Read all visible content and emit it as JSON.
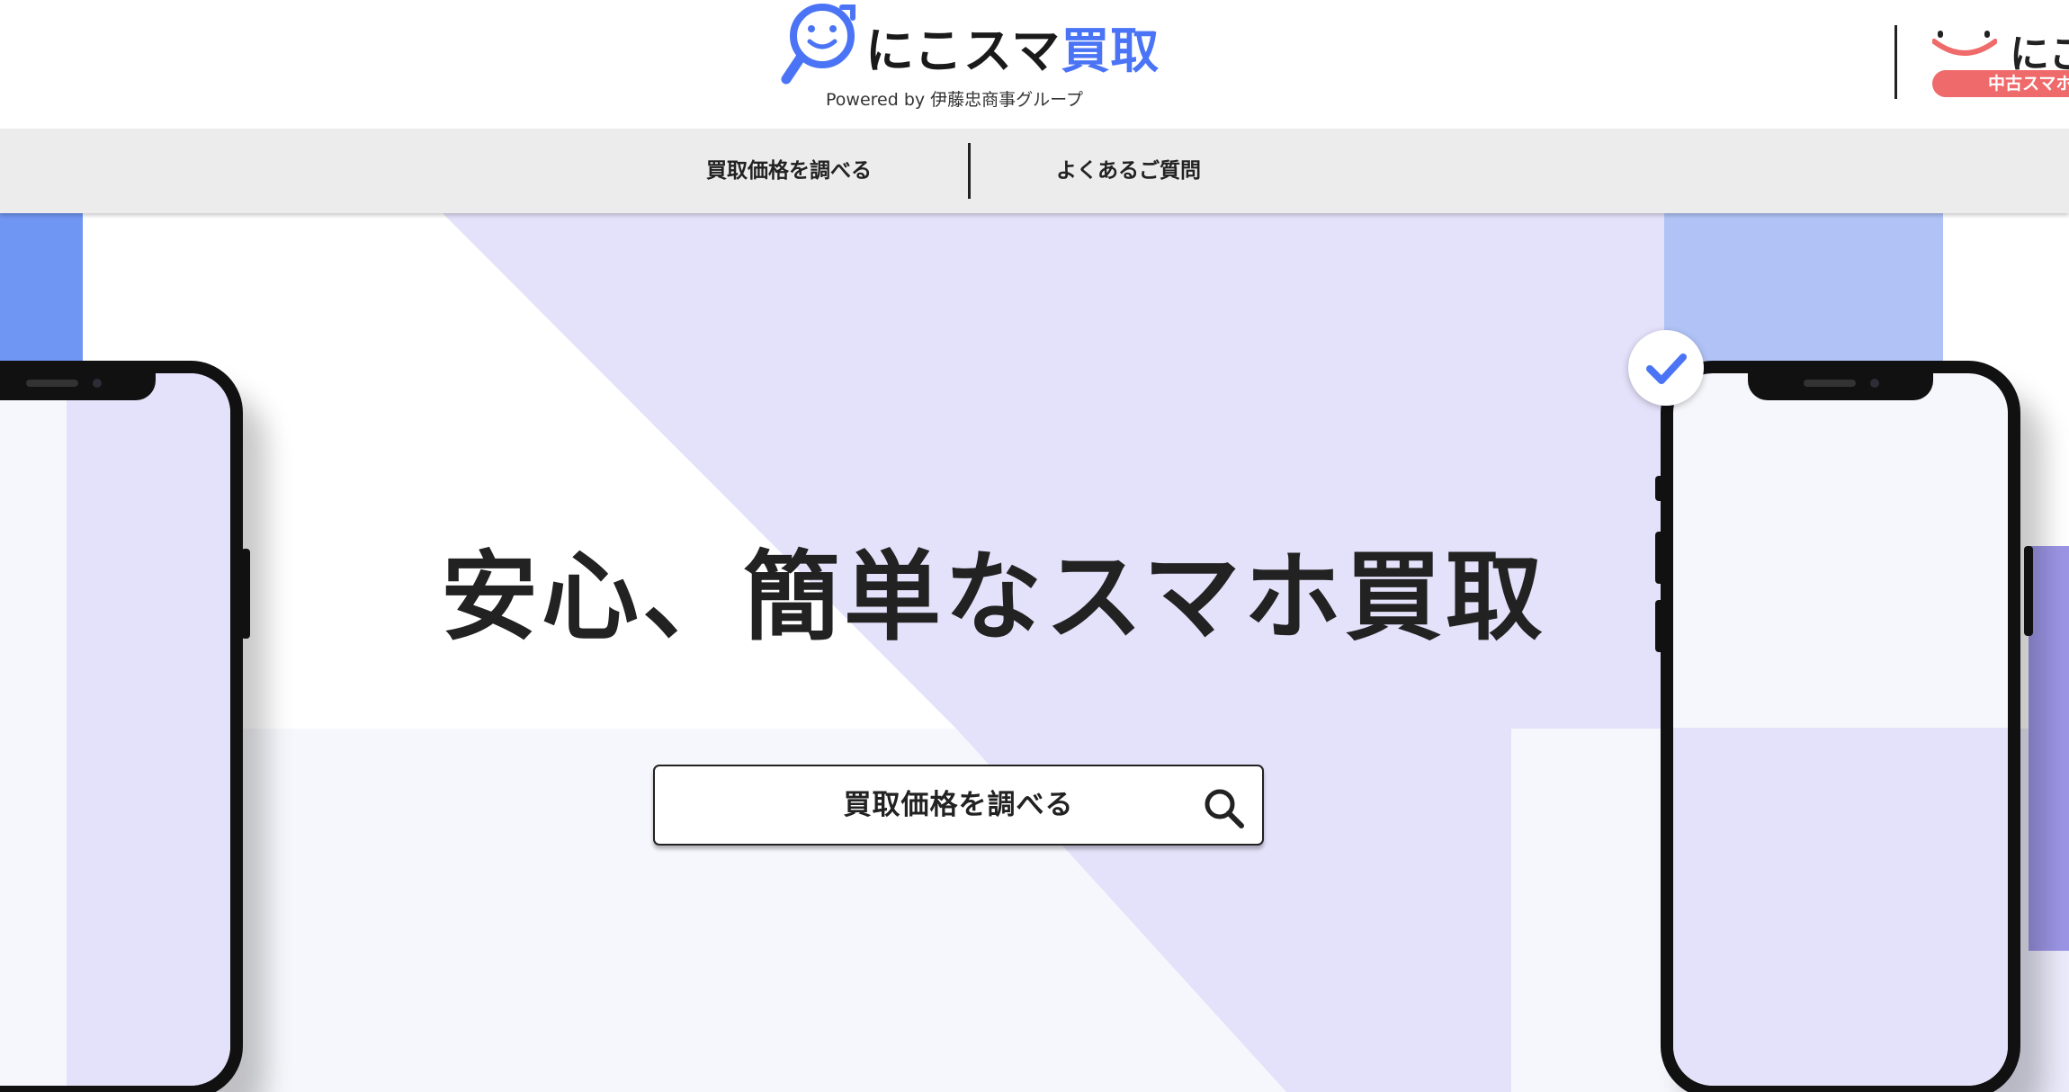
{
  "brand": {
    "name_main": "にこスマ",
    "name_accent": "買取",
    "powered_by": "Powered by 伊藤忠商事グループ",
    "accent_color": "#4a74f5"
  },
  "sister_brand": {
    "name": "にこ",
    "badge": "中古スマホ",
    "badge_color": "#ef6a6a"
  },
  "nav": {
    "items": [
      {
        "label": "買取価格を調べる"
      },
      {
        "label": "よくあるご質問"
      }
    ]
  },
  "hero": {
    "title": "安心、簡単なスマホ買取",
    "cta_label": "買取価格を調べる",
    "cta_icon": "search-icon",
    "badge_icon": "check-icon"
  },
  "colors": {
    "lavender": "#e4e1fa",
    "blue": "#6f96f2",
    "light_blue": "#b1c3f6",
    "pale": "#f6f7fc"
  }
}
